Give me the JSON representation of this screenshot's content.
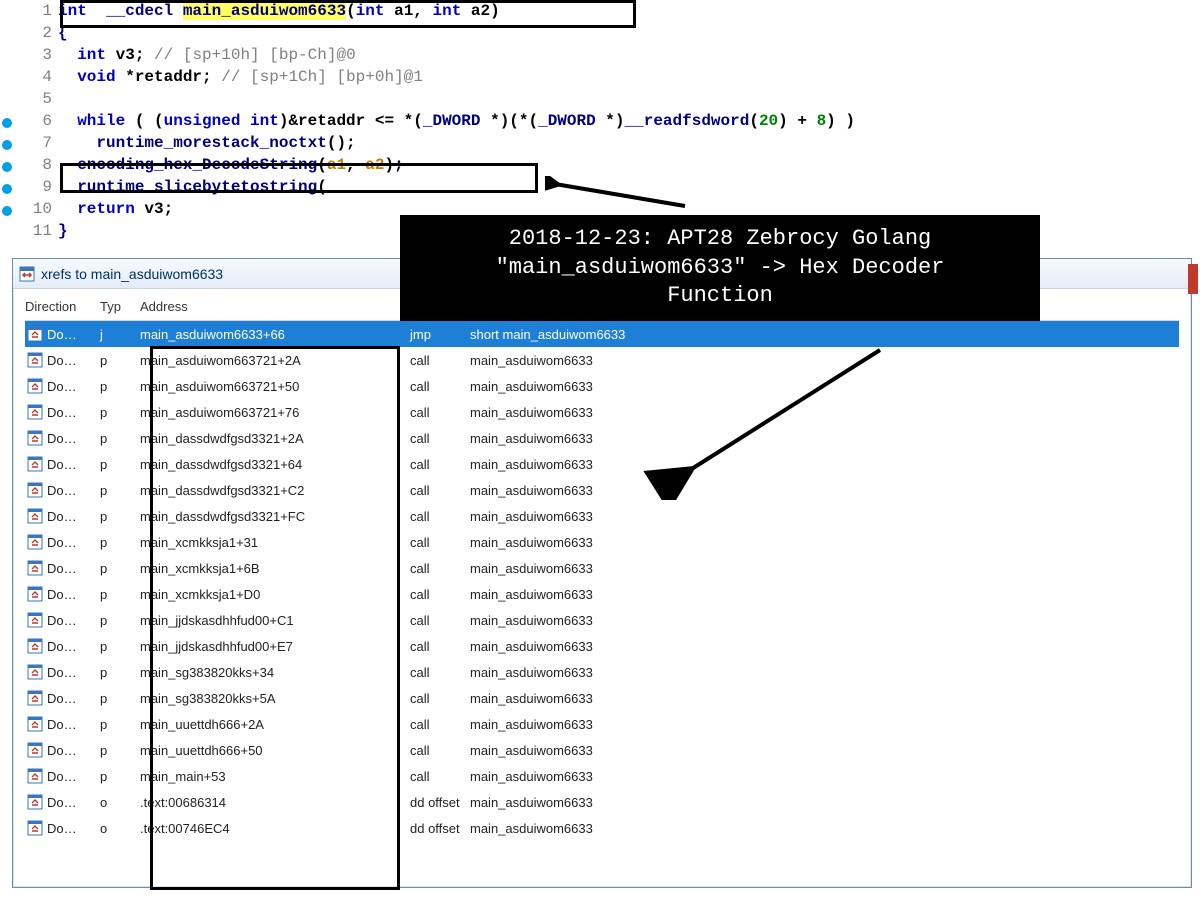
{
  "annotation": {
    "line1": "2018-12-23: APT28 Zebrocy Golang",
    "line2": "\"main_asduiwom6633\" -> Hex Decoder",
    "line3": "Function"
  },
  "code_lines": [
    {
      "n": "1",
      "bp": false,
      "segments": [
        {
          "t": "int ",
          "c": "kw-blue"
        },
        {
          "t": " __cdecl ",
          "c": "kw-navy"
        },
        {
          "t": "main_asduiwom6633",
          "c": "hl-yellow kw-navy"
        },
        {
          "t": "(",
          "c": ""
        },
        {
          "t": "int",
          "c": "kw-blue"
        },
        {
          "t": " a1, ",
          "c": ""
        },
        {
          "t": "int",
          "c": "kw-blue"
        },
        {
          "t": " a2)",
          "c": ""
        }
      ]
    },
    {
      "n": "2",
      "bp": false,
      "segments": [
        {
          "t": "{",
          "c": "kw-navy"
        }
      ]
    },
    {
      "n": "3",
      "bp": false,
      "segments": [
        {
          "t": "  int",
          "c": "kw-blue"
        },
        {
          "t": " v3; ",
          "c": ""
        },
        {
          "t": "// [sp+10h] [bp-Ch]@0",
          "c": "comment"
        }
      ]
    },
    {
      "n": "4",
      "bp": false,
      "segments": [
        {
          "t": "  void",
          "c": "kw-blue"
        },
        {
          "t": " *retaddr; ",
          "c": ""
        },
        {
          "t": "// [sp+1Ch] [bp+0h]@1",
          "c": "comment"
        }
      ]
    },
    {
      "n": "5",
      "bp": false,
      "segments": [
        {
          "t": " ",
          "c": ""
        }
      ]
    },
    {
      "n": "6",
      "bp": true,
      "segments": [
        {
          "t": "  while",
          "c": "kw-blue"
        },
        {
          "t": " ( (",
          "c": ""
        },
        {
          "t": "unsigned int",
          "c": "kw-blue"
        },
        {
          "t": ")&retaddr <= *(",
          "c": ""
        },
        {
          "t": "_DWORD",
          "c": "kw-navy"
        },
        {
          "t": " *)(*(",
          "c": ""
        },
        {
          "t": "_DWORD",
          "c": "kw-navy"
        },
        {
          "t": " *)",
          "c": ""
        },
        {
          "t": "__readfsdword",
          "c": "kw-navy"
        },
        {
          "t": "(",
          "c": ""
        },
        {
          "t": "20",
          "c": "lit"
        },
        {
          "t": ") + ",
          "c": ""
        },
        {
          "t": "8",
          "c": "lit"
        },
        {
          "t": ") )",
          "c": ""
        }
      ]
    },
    {
      "n": "7",
      "bp": true,
      "segments": [
        {
          "t": "    runtime_morestack_noctxt",
          "c": "kw-navy"
        },
        {
          "t": "();",
          "c": ""
        }
      ]
    },
    {
      "n": "8",
      "bp": true,
      "segments": [
        {
          "t": "  encoding_hex_DecodeString",
          "c": "kw-navy"
        },
        {
          "t": "(",
          "c": ""
        },
        {
          "t": "a1",
          "c": "hilite-param"
        },
        {
          "t": ", ",
          "c": ""
        },
        {
          "t": "a2",
          "c": "hilite-param"
        },
        {
          "t": ");",
          "c": ""
        }
      ]
    },
    {
      "n": "9",
      "bp": true,
      "segments": [
        {
          "t": "  runtime_slicebytetostring",
          "c": "kw-navy"
        },
        {
          "t": "(",
          "c": ""
        }
      ]
    },
    {
      "n": "10",
      "bp": true,
      "segments": [
        {
          "t": "  return",
          "c": "kw-blue"
        },
        {
          "t": " v3;",
          "c": ""
        }
      ]
    },
    {
      "n": "11",
      "bp": false,
      "segments": [
        {
          "t": "}",
          "c": "kw-navy"
        }
      ]
    }
  ],
  "xrefs": {
    "title": "xrefs to main_asduiwom6633",
    "headers": {
      "dir": "Direction",
      "typ": "Typ",
      "addr": "Address"
    },
    "rows": [
      {
        "dir": "Do…",
        "typ": "j",
        "addr": "main_asduiwom6633+66",
        "inst": "jmp",
        "target": "short main_asduiwom6633",
        "sel": true
      },
      {
        "dir": "Do…",
        "typ": "p",
        "addr": "main_asduiwom663721+2A",
        "inst": "call",
        "target": "main_asduiwom6633",
        "sel": false
      },
      {
        "dir": "Do…",
        "typ": "p",
        "addr": "main_asduiwom663721+50",
        "inst": "call",
        "target": "main_asduiwom6633",
        "sel": false
      },
      {
        "dir": "Do…",
        "typ": "p",
        "addr": "main_asduiwom663721+76",
        "inst": "call",
        "target": "main_asduiwom6633",
        "sel": false
      },
      {
        "dir": "Do…",
        "typ": "p",
        "addr": "main_dassdwdfgsd3321+2A",
        "inst": "call",
        "target": "main_asduiwom6633",
        "sel": false
      },
      {
        "dir": "Do…",
        "typ": "p",
        "addr": "main_dassdwdfgsd3321+64",
        "inst": "call",
        "target": "main_asduiwom6633",
        "sel": false
      },
      {
        "dir": "Do…",
        "typ": "p",
        "addr": "main_dassdwdfgsd3321+C2",
        "inst": "call",
        "target": "main_asduiwom6633",
        "sel": false
      },
      {
        "dir": "Do…",
        "typ": "p",
        "addr": "main_dassdwdfgsd3321+FC",
        "inst": "call",
        "target": "main_asduiwom6633",
        "sel": false
      },
      {
        "dir": "Do…",
        "typ": "p",
        "addr": "main_xcmkksja1+31",
        "inst": "call",
        "target": "main_asduiwom6633",
        "sel": false
      },
      {
        "dir": "Do…",
        "typ": "p",
        "addr": "main_xcmkksja1+6B",
        "inst": "call",
        "target": "main_asduiwom6633",
        "sel": false
      },
      {
        "dir": "Do…",
        "typ": "p",
        "addr": "main_xcmkksja1+D0",
        "inst": "call",
        "target": "main_asduiwom6633",
        "sel": false
      },
      {
        "dir": "Do…",
        "typ": "p",
        "addr": "main_jjdskasdhhfud00+C1",
        "inst": "call",
        "target": "main_asduiwom6633",
        "sel": false
      },
      {
        "dir": "Do…",
        "typ": "p",
        "addr": "main_jjdskasdhhfud00+E7",
        "inst": "call",
        "target": "main_asduiwom6633",
        "sel": false
      },
      {
        "dir": "Do…",
        "typ": "p",
        "addr": "main_sg383820kks+34",
        "inst": "call",
        "target": "main_asduiwom6633",
        "sel": false
      },
      {
        "dir": "Do…",
        "typ": "p",
        "addr": "main_sg383820kks+5A",
        "inst": "call",
        "target": "main_asduiwom6633",
        "sel": false
      },
      {
        "dir": "Do…",
        "typ": "p",
        "addr": "main_uuettdh666+2A",
        "inst": "call",
        "target": "main_asduiwom6633",
        "sel": false
      },
      {
        "dir": "Do…",
        "typ": "p",
        "addr": "main_uuettdh666+50",
        "inst": "call",
        "target": "main_asduiwom6633",
        "sel": false
      },
      {
        "dir": "Do…",
        "typ": "p",
        "addr": "main_main+53",
        "inst": "call",
        "target": "main_asduiwom6633",
        "sel": false
      },
      {
        "dir": "Do…",
        "typ": "o",
        "addr": ".text:00686314",
        "inst": "dd offset",
        "target": "main_asduiwom6633",
        "sel": false
      },
      {
        "dir": "Do…",
        "typ": "o",
        "addr": ".text:00746EC4",
        "inst": "dd offset",
        "target": "main_asduiwom6633",
        "sel": false
      }
    ]
  }
}
